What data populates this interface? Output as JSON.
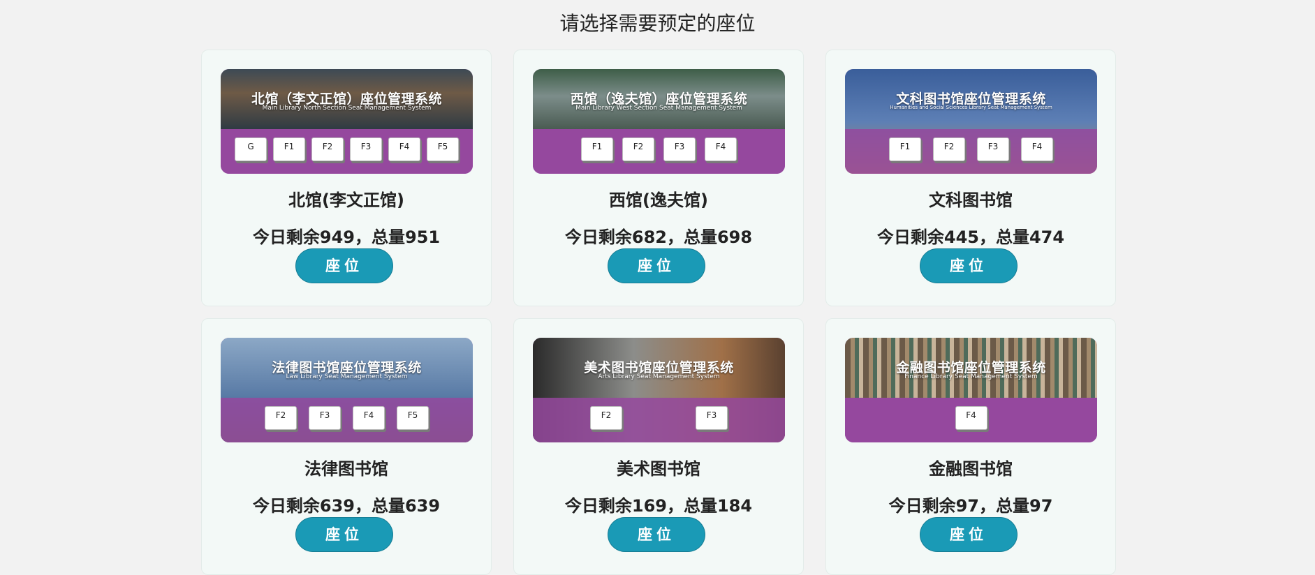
{
  "page": {
    "title": "请选择需要预定的座位"
  },
  "libraries": [
    {
      "name": "北馆(李文正馆)",
      "banner_title": "北馆（李文正馆）座位管理系统",
      "banner_subtitle": "Main Library North Section Seat Management System",
      "floors": [
        "G",
        "F1",
        "F2",
        "F3",
        "F4",
        "F5"
      ],
      "stats": "今日剩余949，总量951",
      "remaining": 949,
      "total": 951,
      "button_label": "座位"
    },
    {
      "name": "西馆(逸夫馆)",
      "banner_title": "西馆（逸夫馆）座位管理系统",
      "banner_subtitle": "Main Library West Section Seat Management System",
      "floors": [
        "F1",
        "F2",
        "F3",
        "F4"
      ],
      "stats": "今日剩余682，总量698",
      "remaining": 682,
      "total": 698,
      "button_label": "座位"
    },
    {
      "name": "文科图书馆",
      "banner_title": "文科图书馆座位管理系统",
      "banner_subtitle": "Humanities and Social Sciences Library Seat Management System",
      "floors": [
        "F1",
        "F2",
        "F3",
        "F4"
      ],
      "stats": "今日剩余445，总量474",
      "remaining": 445,
      "total": 474,
      "button_label": "座位"
    },
    {
      "name": "法律图书馆",
      "banner_title": "法律图书馆座位管理系统",
      "banner_subtitle": "Law Library Seat Management System",
      "floors": [
        "F2",
        "F3",
        "F4",
        "F5"
      ],
      "stats": "今日剩余639，总量639",
      "remaining": 639,
      "total": 639,
      "button_label": "座位"
    },
    {
      "name": "美术图书馆",
      "banner_title": "美术图书馆座位管理系统",
      "banner_subtitle": "Arts Library Seat Management System",
      "floors": [
        "F2",
        "F3"
      ],
      "stats": "今日剩余169，总量184",
      "remaining": 169,
      "total": 184,
      "button_label": "座位"
    },
    {
      "name": "金融图书馆",
      "banner_title": "金融图书馆座位管理系统",
      "banner_subtitle": "Finance Library Seat Management System",
      "floors": [
        "F4"
      ],
      "stats": "今日剩余97，总量97",
      "remaining": 97,
      "total": 97,
      "button_label": "座位"
    }
  ],
  "colors": {
    "page_bg": "#f2f2f2",
    "card_bg": "#f3f9f7",
    "banner_purple": "#95489e",
    "button": "#1a9ab6"
  }
}
